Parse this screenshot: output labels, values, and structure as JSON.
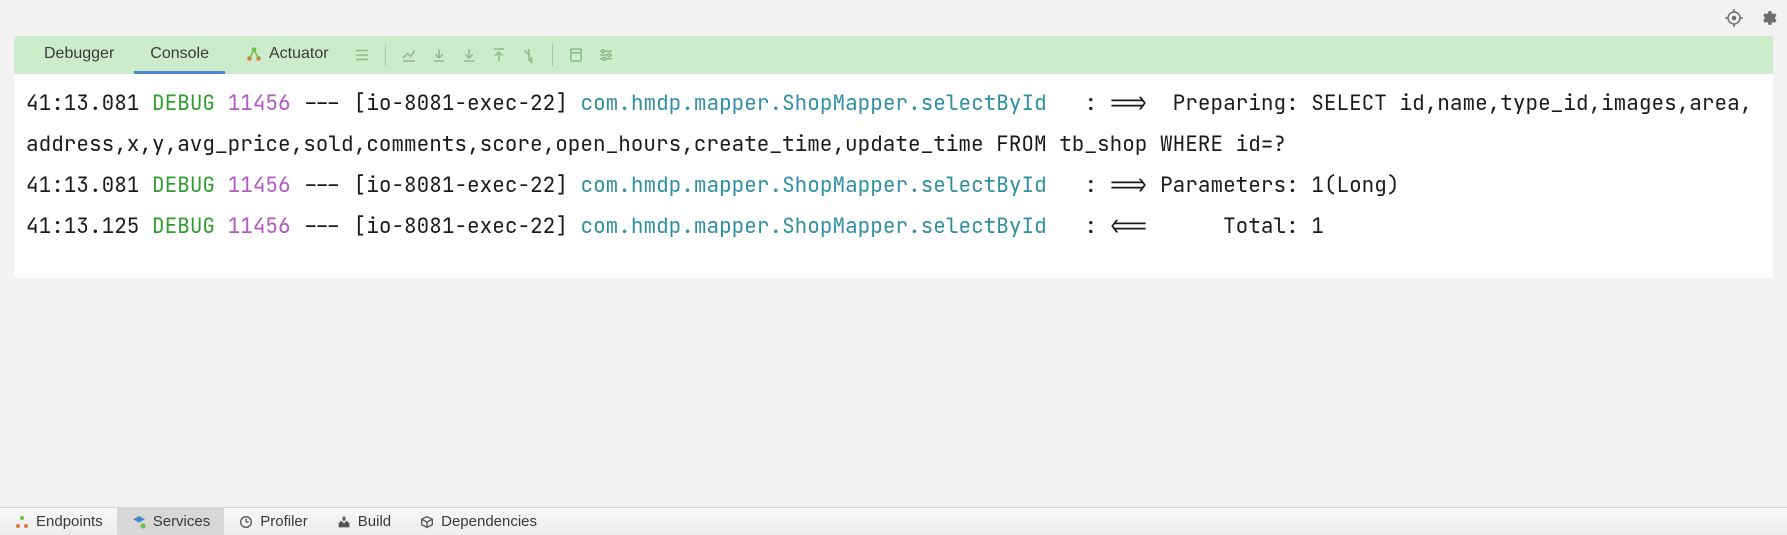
{
  "topIcons": {
    "target": "target-icon",
    "gear": "gear-icon"
  },
  "tabs": {
    "debugger": "Debugger",
    "console": "Console",
    "actuator": "Actuator"
  },
  "log": [
    {
      "ts": "41:13.081",
      "level": "DEBUG",
      "pid": "11456",
      "sep": "---",
      "thread": "[io-8081-exec-22]",
      "cls": "com.hmdp.mapper.ShopMapper.selectById",
      "msg": "   : ==>  Preparing: SELECT id,name,type_id,images,area,address,x,y,avg_price,sold,comments,score,open_hours,create_time,update_time FROM tb_shop WHERE id=?"
    },
    {
      "ts": "41:13.081",
      "level": "DEBUG",
      "pid": "11456",
      "sep": "---",
      "thread": "[io-8081-exec-22]",
      "cls": "com.hmdp.mapper.ShopMapper.selectById",
      "msg": "   : ==> Parameters: 1(Long)"
    },
    {
      "ts": "41:13.125",
      "level": "DEBUG",
      "pid": "11456",
      "sep": "---",
      "thread": "[io-8081-exec-22]",
      "cls": "com.hmdp.mapper.ShopMapper.selectById",
      "msg": "   : <==      Total: 1"
    }
  ],
  "bottomTabs": {
    "endpoints": "Endpoints",
    "services": "Services",
    "profiler": "Profiler",
    "build": "Build",
    "dependencies": "Dependencies"
  }
}
